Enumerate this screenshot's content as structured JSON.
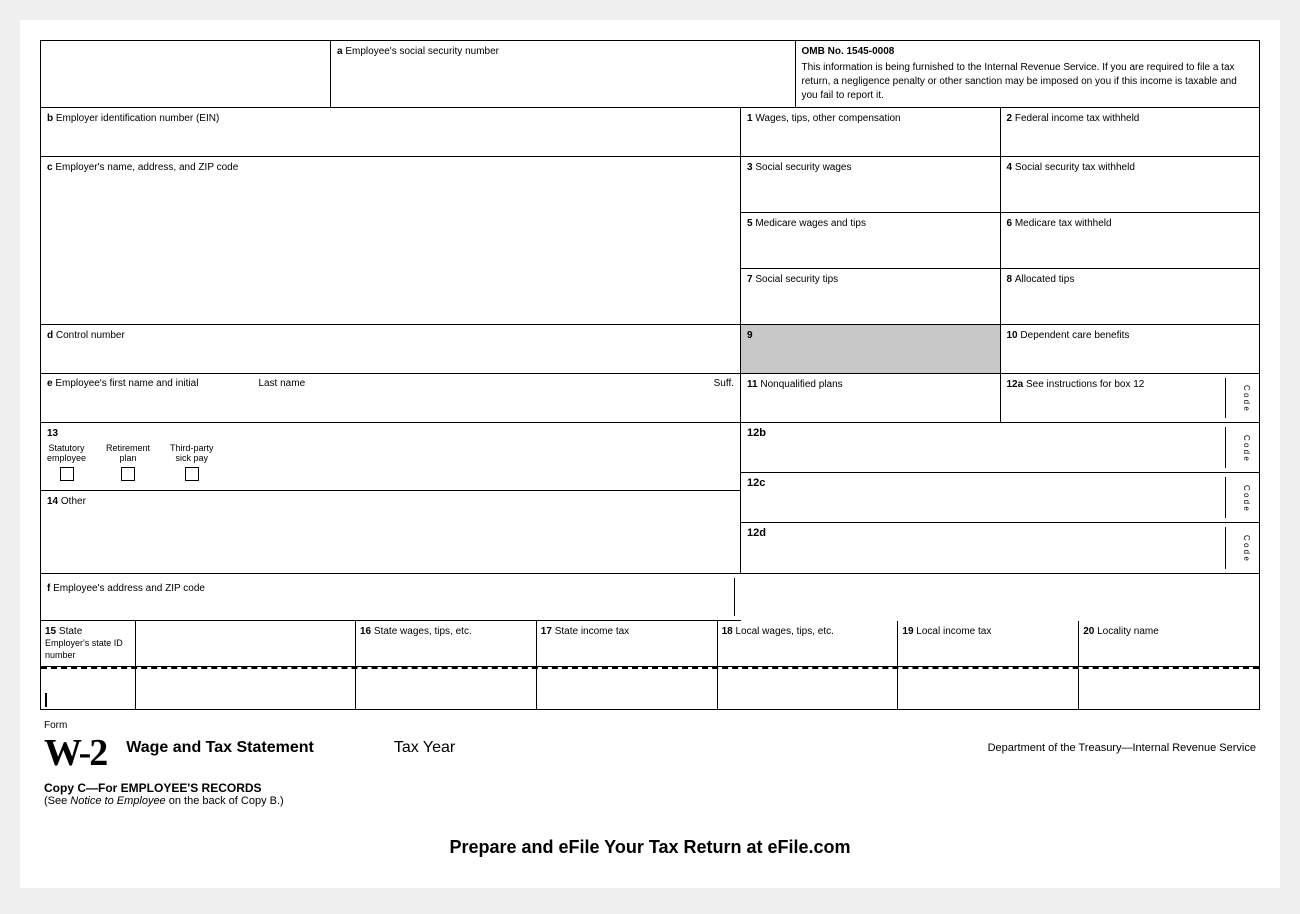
{
  "form": {
    "title": "W-2",
    "form_label": "Form",
    "subtitle": "Wage and Tax Statement",
    "tax_year": "Tax Year",
    "irs_dept": "Department of the Treasury—Internal Revenue Service",
    "copy_label": "Copy C—For EMPLOYEE'S RECORDS",
    "copy_note_prefix": "(See ",
    "copy_note_italic": "Notice to Employee",
    "copy_note_suffix": " on the back of Copy B.)",
    "cta": "Prepare and eFile Your Tax Return at eFile.com"
  },
  "fields": {
    "a_label": "a",
    "a_text": "Employee's social security number",
    "omb": "OMB No. 1545-0008",
    "irs_notice": "This information is being furnished to the Internal Revenue Service. If you are required to file a tax return, a negligence penalty or other sanction may be imposed on you if this income is taxable and you fail to report it.",
    "b_label": "b",
    "b_text": "Employer identification number (EIN)",
    "box1_num": "1",
    "box1_text": "Wages, tips, other compensation",
    "box2_num": "2",
    "box2_text": "Federal income tax withheld",
    "c_label": "c",
    "c_text": "Employer's name, address, and ZIP code",
    "box3_num": "3",
    "box3_text": "Social security wages",
    "box4_num": "4",
    "box4_text": "Social security tax withheld",
    "box5_num": "5",
    "box5_text": "Medicare wages and tips",
    "box6_num": "6",
    "box6_text": "Medicare tax withheld",
    "box7_num": "7",
    "box7_text": "Social security tips",
    "box8_num": "8",
    "box8_text": "Allocated tips",
    "d_label": "d",
    "d_text": "Control number",
    "box9_num": "9",
    "box10_num": "10",
    "box10_text": "Dependent care benefits",
    "e_label": "e",
    "e_first": "Employee's first name and initial",
    "e_last": "Last name",
    "e_suff": "Suff.",
    "box11_num": "11",
    "box11_text": "Nonqualified plans",
    "box12a_num": "12a",
    "box12a_text": "See instructions for box 12",
    "box12a_code": "C\no\nd\ne",
    "box13_num": "13",
    "box13_stat": "Statutory\nemployee",
    "box13_retire": "Retirement\nplan",
    "box13_third": "Third-party\nsick pay",
    "box12b_num": "12b",
    "box12b_code": "C\no\nd\ne",
    "box14_num": "14",
    "box14_text": "Other",
    "box12c_num": "12c",
    "box12c_code": "C\no\nd\ne",
    "box12d_num": "12d",
    "box12d_code": "C\no\nd\ne",
    "f_label": "f",
    "f_text": "Employee's address and ZIP code",
    "box15_num": "15",
    "box15_state": "State",
    "box15_id": "Employer's state ID number",
    "box16_num": "16",
    "box16_text": "State wages, tips, etc.",
    "box17_num": "17",
    "box17_text": "State income tax",
    "box18_num": "18",
    "box18_text": "Local wages, tips, etc.",
    "box19_num": "19",
    "box19_text": "Local income tax",
    "box20_num": "20",
    "box20_text": "Locality name"
  }
}
